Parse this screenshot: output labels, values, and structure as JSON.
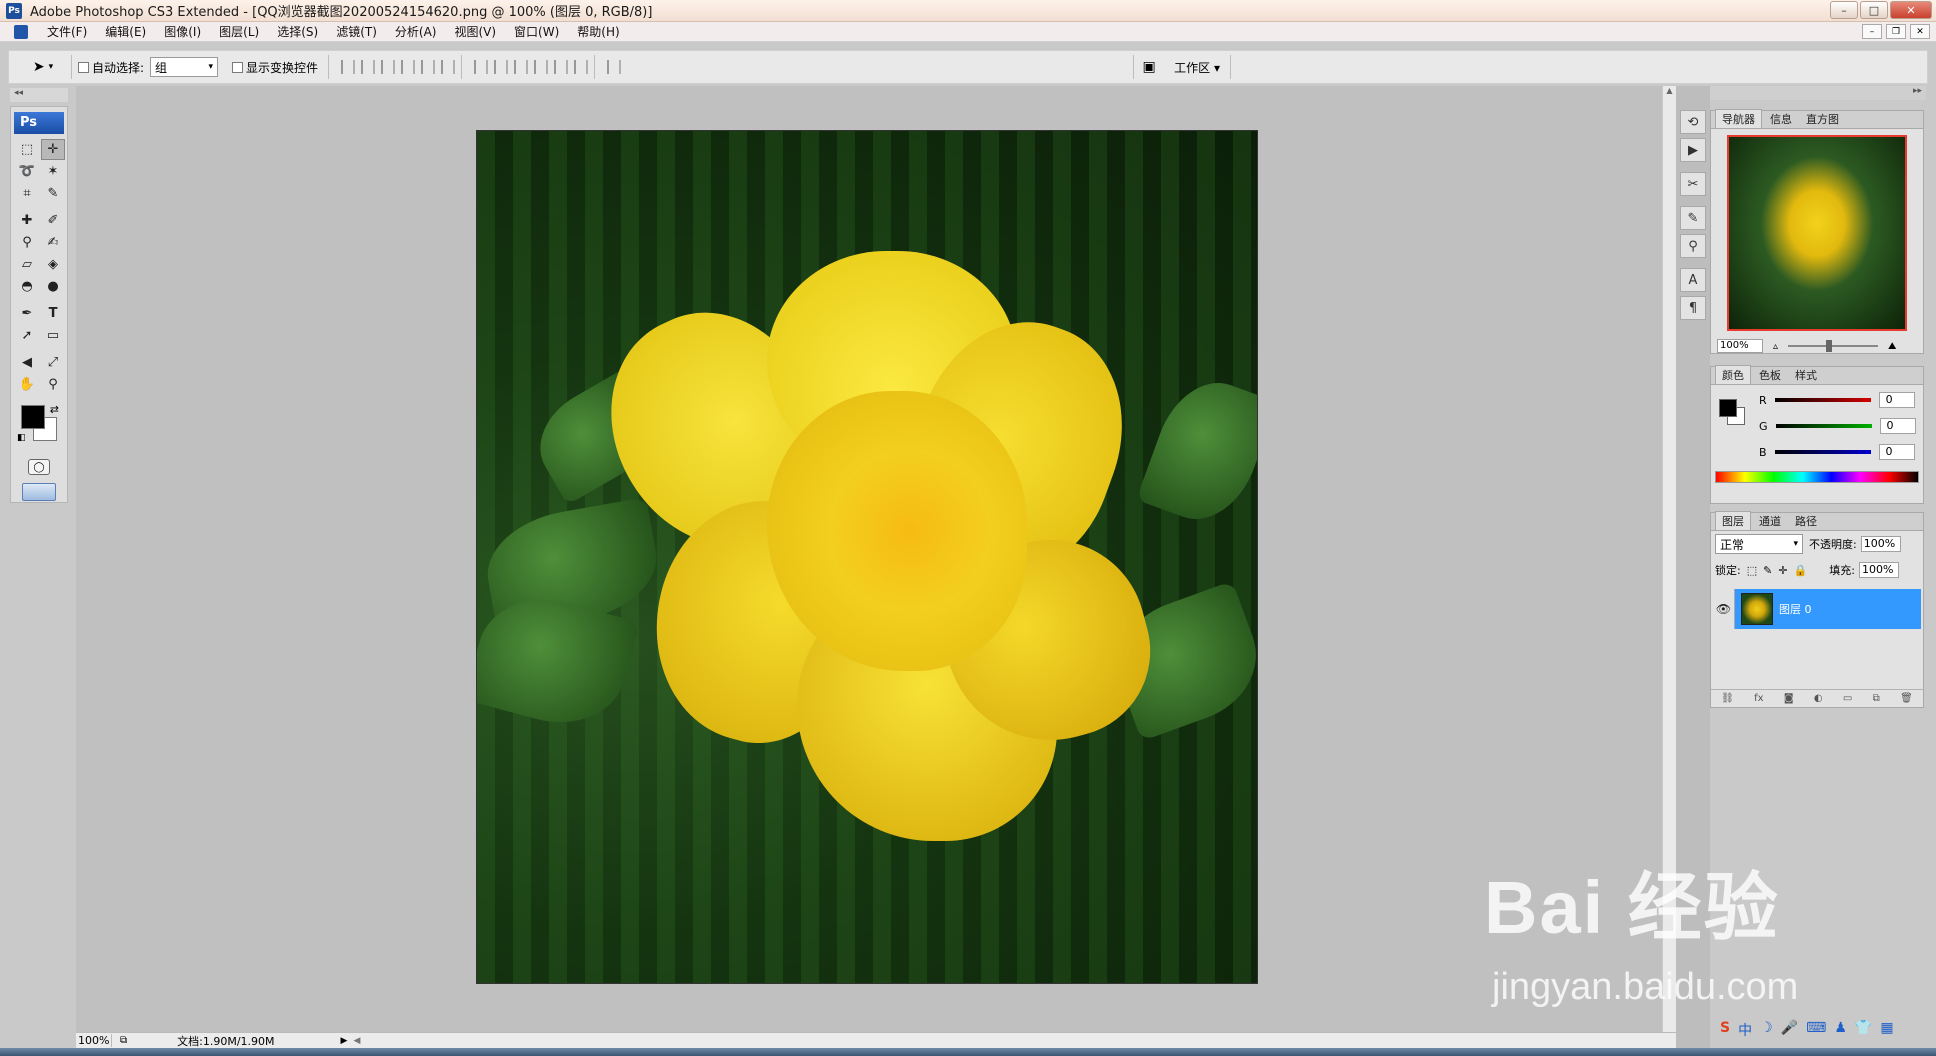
{
  "window": {
    "title": "Adobe Photoshop CS3 Extended - [QQ浏览器截图20200524154620.png @ 100% (图层 0, RGB/8)]",
    "app_badge": "Ps",
    "min": "–",
    "max": "□",
    "close": "✕"
  },
  "menu": [
    "文件(F)",
    "编辑(E)",
    "图像(I)",
    "图层(L)",
    "选择(S)",
    "滤镜(T)",
    "分析(A)",
    "视图(V)",
    "窗口(W)",
    "帮助(H)"
  ],
  "options": {
    "auto_select_label": "自动选择:",
    "auto_select_value": "组",
    "transform_controls_label": "显示变换控件",
    "workspace_label": "工作区 ▾"
  },
  "tools": {
    "badge": "Ps"
  },
  "status": {
    "zoom": "100%",
    "doc_info": "文档:1.90M/1.90M"
  },
  "navigator": {
    "tabs": [
      "导航器",
      "信息",
      "直方图"
    ],
    "zoom": "100%"
  },
  "color_panel": {
    "tabs": [
      "颜色",
      "色板",
      "样式"
    ],
    "channels": [
      {
        "label": "R",
        "value": "0",
        "color": "#d40000"
      },
      {
        "label": "G",
        "value": "0",
        "color": "#00b000"
      },
      {
        "label": "B",
        "value": "0",
        "color": "#0000d0"
      }
    ]
  },
  "layers_panel": {
    "tabs": [
      "图层",
      "通道",
      "路径"
    ],
    "blend_mode": "正常",
    "opacity_label": "不透明度:",
    "opacity": "100%",
    "lock_label": "锁定:",
    "fill_label": "填充:",
    "fill": "100%",
    "layer_name": "图层 0"
  },
  "watermark": {
    "main": "Bai  经验",
    "url": "jingyan.baidu.com"
  }
}
